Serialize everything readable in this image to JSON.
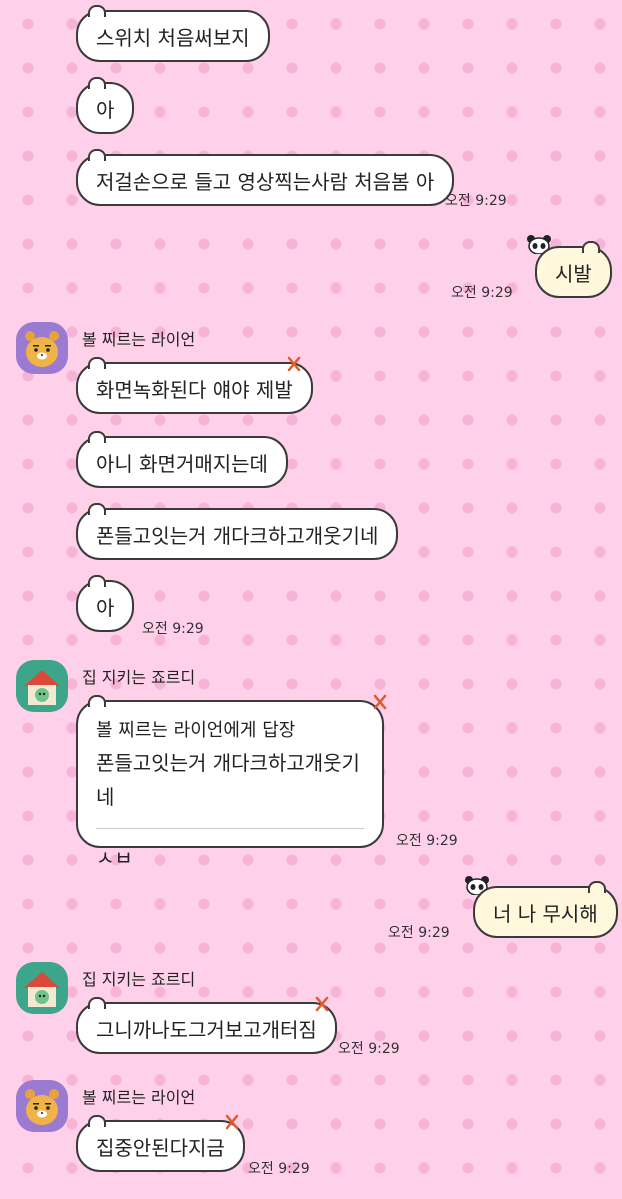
{
  "messages": [
    {
      "text": "스위치 처음써보지"
    },
    {
      "text": "아"
    },
    {
      "text": "저걸손으로 들고 영상찍는사람 처음봄 아",
      "time": "오전 9:29"
    },
    {
      "text": "시발",
      "time": "오전 9:29"
    },
    {
      "sender": "볼 찌르는 라이언",
      "text": "화면녹화된다 얘야 제발"
    },
    {
      "text": "아니 화면거매지는데"
    },
    {
      "text": "폰들고잇는거 개다크하고개웃기네"
    },
    {
      "text": "아",
      "time": "오전 9:29"
    },
    {
      "sender": "집 지키는 죠르디",
      "reply_to": "볼 찌르는 라이언에게 답장",
      "reply_quote": "폰들고잇는거 개다크하고개웃기네",
      "text": "ㅅㅂ",
      "time": "오전 9:29"
    },
    {
      "text": "너 나 무시해",
      "time": "오전 9:29"
    },
    {
      "sender": "집 지키는 죠르디",
      "text": "그니까나도그거보고개터짐",
      "time": "오전 9:29"
    },
    {
      "sender": "볼 찌르는 라이언",
      "text": "집중안된다지금",
      "time": "오전 9:29"
    }
  ]
}
